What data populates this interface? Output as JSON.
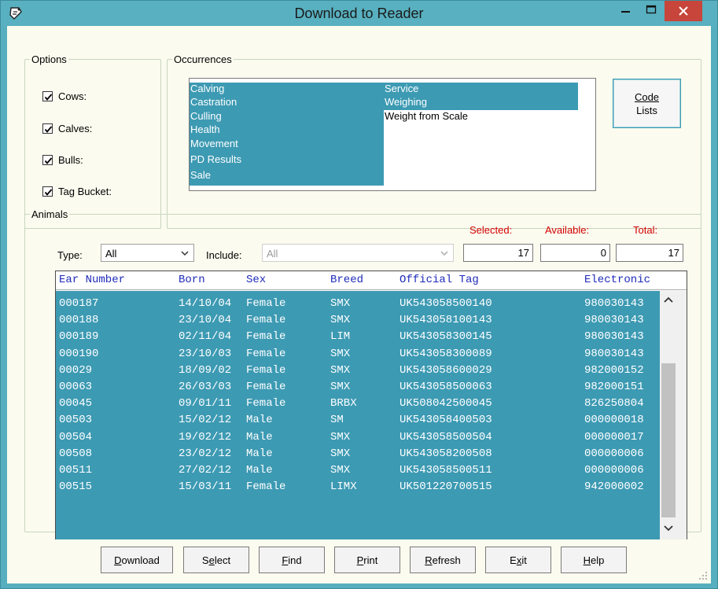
{
  "window": {
    "title": "Download to Reader",
    "accent": "#58b0c0",
    "selection_color": "#3d9ab3"
  },
  "options": {
    "legend": "Options",
    "items": [
      {
        "label": "Cows:",
        "checked": true
      },
      {
        "label": "Calves:",
        "checked": true
      },
      {
        "label": "Bulls:",
        "checked": true
      },
      {
        "label": "Tag Bucket:",
        "checked": true
      }
    ]
  },
  "occurrences": {
    "legend": "Occurrences",
    "column1": [
      {
        "label": "Calving",
        "selected": true
      },
      {
        "label": "Castration",
        "selected": true
      },
      {
        "label": "Culling",
        "selected": true
      },
      {
        "label": "Health",
        "selected": true
      },
      {
        "label": "Movement",
        "selected": true
      },
      {
        "label": "PD Results",
        "selected": true
      },
      {
        "label": "Sale",
        "selected": true
      }
    ],
    "column2": [
      {
        "label": "Service",
        "selected": true
      },
      {
        "label": "Weighing",
        "selected": true
      },
      {
        "label": "Weight from Scale",
        "selected": false
      }
    ]
  },
  "code_lists_button": {
    "line1": "Code",
    "line2": "Lists"
  },
  "animals": {
    "legend": "Animals",
    "type_label": "Type:",
    "type_value": "All",
    "include_label": "Include:",
    "include_value": "All",
    "selected_label": "Selected:",
    "available_label": "Available:",
    "total_label": "Total:",
    "selected_count": "17",
    "available_count": "0",
    "total_count": "17"
  },
  "grid": {
    "columns": [
      "Ear Number",
      "Born",
      "Sex",
      "Breed",
      "Official Tag",
      "Electronic"
    ],
    "rows": [
      [
        "000187",
        "14/10/04",
        "Female",
        "SMX",
        "UK543058500140",
        "980030143"
      ],
      [
        "000188",
        "23/10/04",
        "Female",
        "SMX",
        "UK543058100143",
        "980030143"
      ],
      [
        "000189",
        "02/11/04",
        "Female",
        "LIM",
        "UK543058300145",
        "980030143"
      ],
      [
        "000190",
        "23/10/03",
        "Female",
        "SMX",
        "UK543058300089",
        "980030143"
      ],
      [
        "00029",
        "18/09/02",
        "Female",
        "SMX",
        "UK543058600029",
        "982000152"
      ],
      [
        "00063",
        "26/03/03",
        "Female",
        "SMX",
        "UK543058500063",
        "982000151"
      ],
      [
        "00045",
        "09/01/11",
        "Female",
        "BRBX",
        "UK508042500045",
        "826250804"
      ],
      [
        "00503",
        "15/02/12",
        "Male",
        "SM",
        "UK543058400503",
        "000000018"
      ],
      [
        "00504",
        "19/02/12",
        "Male",
        "SMX",
        "UK543058500504",
        "000000017"
      ],
      [
        "00508",
        "23/02/12",
        "Male",
        "SMX",
        "UK543058200508",
        "000000006"
      ],
      [
        "00511",
        "27/02/12",
        "Male",
        "SMX",
        "UK543058500511",
        "000000006"
      ],
      [
        "00515",
        "15/03/11",
        "Female",
        "LIMX",
        "UK501220700515",
        "942000002"
      ]
    ]
  },
  "buttons": {
    "download": {
      "accel": "D",
      "rest": "ownload"
    },
    "select": {
      "pre": "S",
      "accel": "e",
      "rest": "lect"
    },
    "find": {
      "accel": "F",
      "rest": "ind"
    },
    "print": {
      "accel": "P",
      "rest": "rint"
    },
    "refresh": {
      "accel": "R",
      "rest": "efresh"
    },
    "exit": {
      "pre": "E",
      "accel": "x",
      "rest": "it"
    },
    "help": {
      "accel": "H",
      "rest": "elp"
    }
  }
}
